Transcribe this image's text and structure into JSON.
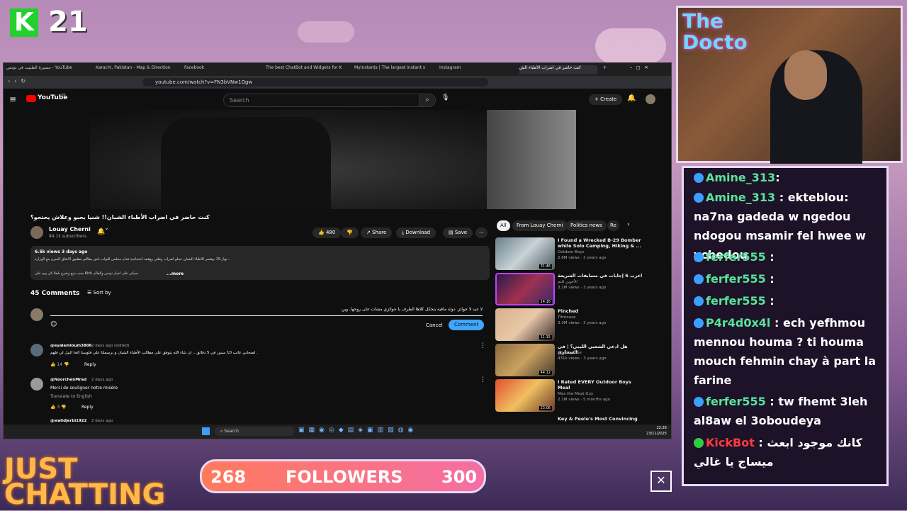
{
  "overlay": {
    "kick_badge": "K",
    "kick_number": "21",
    "just_chatting_1": "JUST",
    "just_chatting_2": "CHATTING",
    "followers_current": "268",
    "followers_label": "FOLLOWERS",
    "followers_goal": "300",
    "webcam_sign": "The Docto",
    "close_glyph": "✕"
  },
  "browser": {
    "tabs": [
      {
        "label": "مسيرة الطبيب في تونس - YouTube"
      },
      {
        "label": "Karachi, Pakistan - Map & Direction"
      },
      {
        "label": "Facebook"
      },
      {
        "label": "The best ChatBot and Widgets for K"
      },
      {
        "label": "MyInstants | The largest instant sou"
      },
      {
        "label": "Instagram"
      },
      {
        "label": "كنت حاضر في اضراب الأطباء الش"
      }
    ],
    "url": "youtube.com/watch?v=FN3bVNw1Qgw"
  },
  "youtube": {
    "logo": "YouTube",
    "logo_sup": "BE",
    "search_placeholder": "Search",
    "create_label": "Create",
    "video_title": "كنت حاضر في اضراب الأطباء الشبان!! شنيا يحبو وعلاش يحتجو؟",
    "channel_name": "Louay Cherni",
    "subscribers": "84.1k subscribers",
    "likes": "480",
    "share_label": "Share",
    "download_label": "Download",
    "save_label": "Save",
    "views_date": "6.5k views  3 days ago",
    "desc_line1": "نهار 19 نوفمبر الأطباء الشبان عملو اضراب وطني ووقفة احتجاجية قدام مجلس النواب باش يطالبو بتطبيق الاتفاق المبرم مع الوزارة...",
    "desc_line2": "...more",
    "desc_line3": "يحب يتبع وتفرج بلفلا كل يوم على Kick سيكير على اخبار تونس والعالم",
    "comments_count": "45 Comments",
    "sort_label": "Sort by",
    "comment_draft": "لا عيد لا جوائز. دولة مافية يتحكل كلاها الطرف يا جوائزي مشات على روحها. وين",
    "cancel_label": "Cancel",
    "comment_label": "Comment",
    "comments": [
      {
        "author": "@eyalamloum3806",
        "meta": "2 days ago (edited)",
        "text": "لصحابي عاتب 10 سنين في 5 دقائق .. ان شاء الله يتوفق على مطالب الأطباء الشبان و برسملنا علي فلوسنا الحا البيل لي فلهم .",
        "likes": "14",
        "reply": "Reply"
      },
      {
        "author": "@NoorchenMrad",
        "meta": "2 days ago",
        "text": "Merci de souligner notre misère",
        "translate": "Translate to English",
        "likes": "3",
        "reply": "Reply"
      },
      {
        "author": "@walidjerbi1922",
        "meta": "2 days ago"
      }
    ],
    "chips": [
      "All",
      "From Louay Cherni",
      "Politics news",
      "Re"
    ],
    "recommendations": [
      {
        "title": "I Found a Wrecked B-29 Bomber while Solo Camping, Hiking & ...",
        "channel": "Outdoor Boys",
        "meta": "2.6M views · 3 years ago",
        "duration": "31:46"
      },
      {
        "title": "اعرب 6 إجابات في مسابقات الشريعة",
        "channel": "الأخوين افتم",
        "meta": "3.2M views · 3 years ago",
        "duration": "14:16"
      },
      {
        "title": "Pinched",
        "channel": "Titmouse",
        "meta": "3.3M views · 3 years ago",
        "duration": "11:15"
      },
      {
        "title": "هل ادعي الشعبي الليبي؟ | في الصحارى",
        "channel": "AlarabyTube",
        "meta": "431k views · 3 years ago",
        "duration": "44:12"
      },
      {
        "title": "I Rated EVERY Outdoor Boys Meal",
        "channel": "Max the Meat Guy",
        "meta": "2.1M views · 5 months ago",
        "duration": "23:06"
      },
      {
        "title": "Key & Peele's Most Convincing",
        "channel": "",
        "meta": "",
        "duration": ""
      }
    ]
  },
  "taskbar": {
    "search_label": "Search",
    "time": "22:26",
    "date": "23/11/2025"
  },
  "chat": {
    "messages": [
      {
        "user": "Amine_313",
        "text": ""
      },
      {
        "user": "Amine_313",
        "text": "ekteblou: na7na gadeda w ngedou ndogou msamir fel hwee w ychedou"
      },
      {
        "user": "ferfer555",
        "text": ""
      },
      {
        "user": "ferfer555",
        "text": ""
      },
      {
        "user": "ferfer555",
        "text": ""
      },
      {
        "user": "P4r4d0x4l",
        "text": "ech yefhmou mennou houma ? ti houma mouch fehmin chay à part la farine"
      },
      {
        "user": "ferfer555",
        "text": "tw fhemt 3leh al8aw el 3oboudeya"
      },
      {
        "user": "KickBot",
        "text": "كانك موجود ابعث ميساج يا غالي"
      }
    ],
    "separator": ":"
  }
}
